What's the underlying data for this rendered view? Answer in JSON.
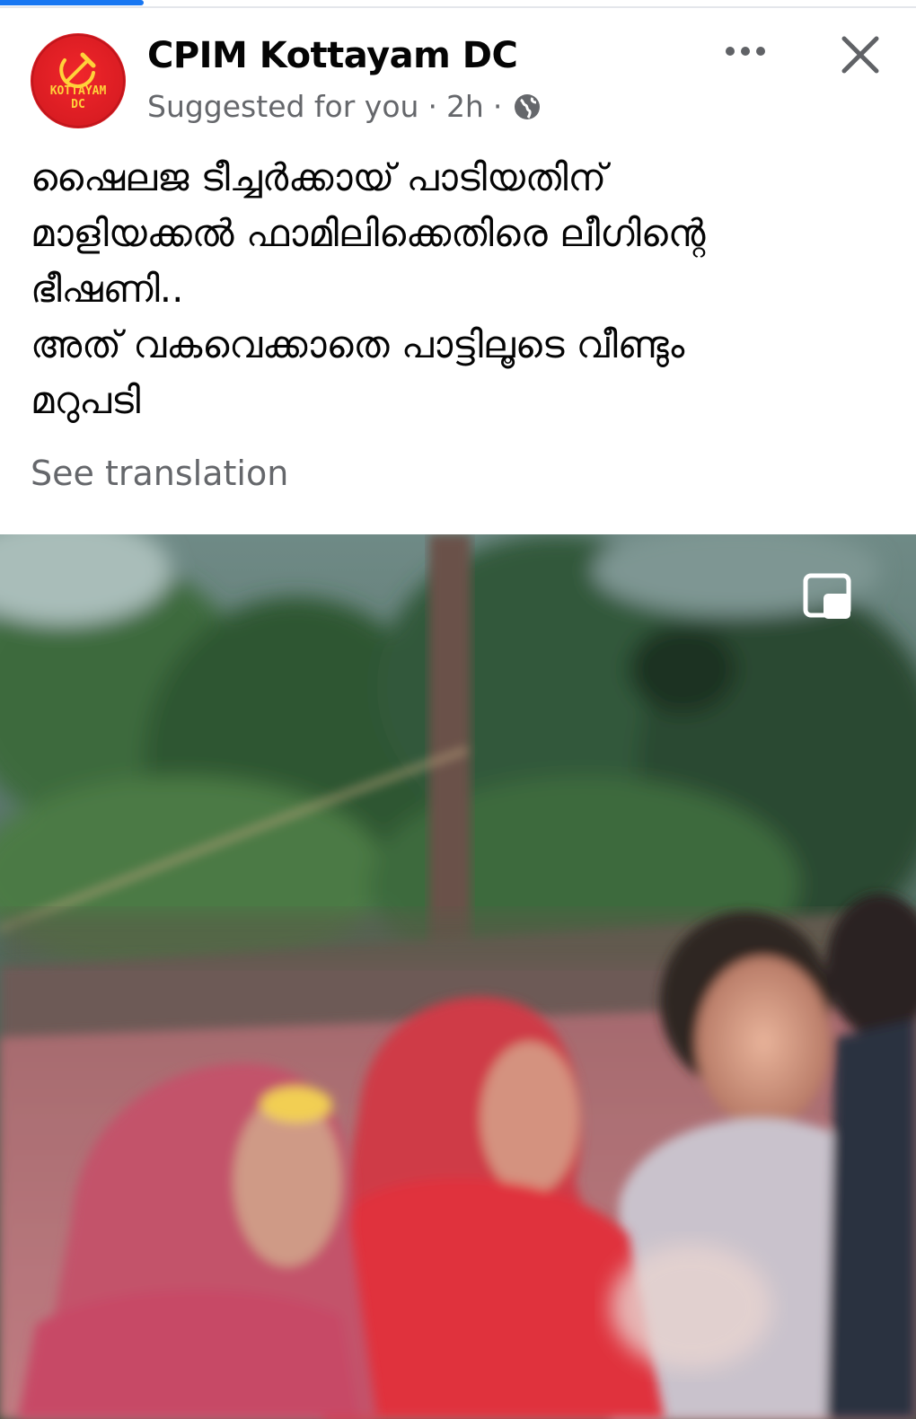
{
  "post": {
    "page_name": "CPIM Kottayam DC",
    "avatar": {
      "logo_line1": "KOTTAYAM",
      "logo_line2": "DC",
      "emblem": "hammer-sickle"
    },
    "meta": {
      "suggested": "Suggested for you",
      "separator": "·",
      "time": "2h",
      "audience_icon": "globe-icon"
    },
    "caption_lines": [
      "ഷൈലജ ടീച്ചർക്കായ് പാടിയതിന്",
      "മാളിയക്കൽ ഫാമിലിക്കെതിരെ ലീഗിന്റെ",
      "ഭീഷണി..",
      "അത് വകവെക്കാതെ പാട്ടിലൂടെ വീണ്ടും",
      "മറുപടി"
    ],
    "see_translation": "See translation"
  },
  "colors": {
    "accent": "#1877f2",
    "text_primary": "#050505",
    "text_secondary": "#65676b",
    "logo_red": "#e0242a",
    "logo_yellow": "#ffd23a"
  },
  "icons": {
    "more": "more-dots-icon",
    "close": "close-icon",
    "pip": "picture-in-picture-icon"
  }
}
